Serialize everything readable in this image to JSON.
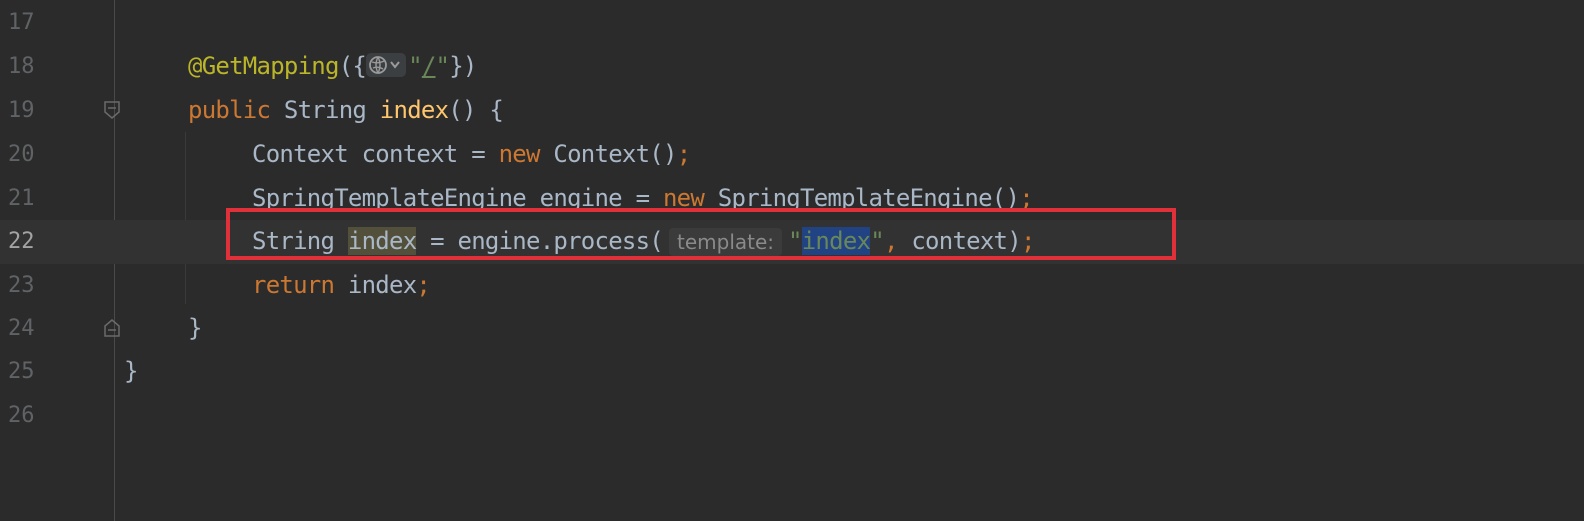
{
  "editor": {
    "lines": [
      {
        "no": "17"
      },
      {
        "no": "18",
        "annotation": "@GetMapping",
        "open": "({",
        "url_quote_open": "\"",
        "url": "/",
        "url_quote_close": "\"",
        "close": "})"
      },
      {
        "no": "19",
        "kw": "public",
        "type": " String ",
        "method": "index",
        "rest": "() {"
      },
      {
        "no": "20",
        "pre": "Context context = ",
        "kw": "new",
        "post": " Context()",
        "semi": ";"
      },
      {
        "no": "21",
        "pre": "SpringTemplateEngine engine = ",
        "kw": "new",
        "post": " SpringTemplateEngine()",
        "semi": ";"
      },
      {
        "no": "22",
        "pre": "String ",
        "var": "index",
        "mid": " = engine.process(",
        "hint": "template:",
        "q1": "\"",
        "arg": "index",
        "q2": "\"",
        "comma": ",",
        "post": " context)",
        "semi": ";"
      },
      {
        "no": "23",
        "kw": "return",
        "post": " index",
        "semi": ";"
      },
      {
        "no": "24",
        "text": "}"
      },
      {
        "no": "25",
        "text": "}"
      },
      {
        "no": "26"
      }
    ],
    "current_line": "22",
    "colors": {
      "background": "#2b2b2b",
      "keyword": "#cc7832",
      "annotation": "#bbb529",
      "method": "#ffc66d",
      "string": "#6a8759",
      "highlight_box": "#e0303a"
    },
    "icons": [
      "globe-icon",
      "chevron-down-icon",
      "fold-icon"
    ]
  }
}
